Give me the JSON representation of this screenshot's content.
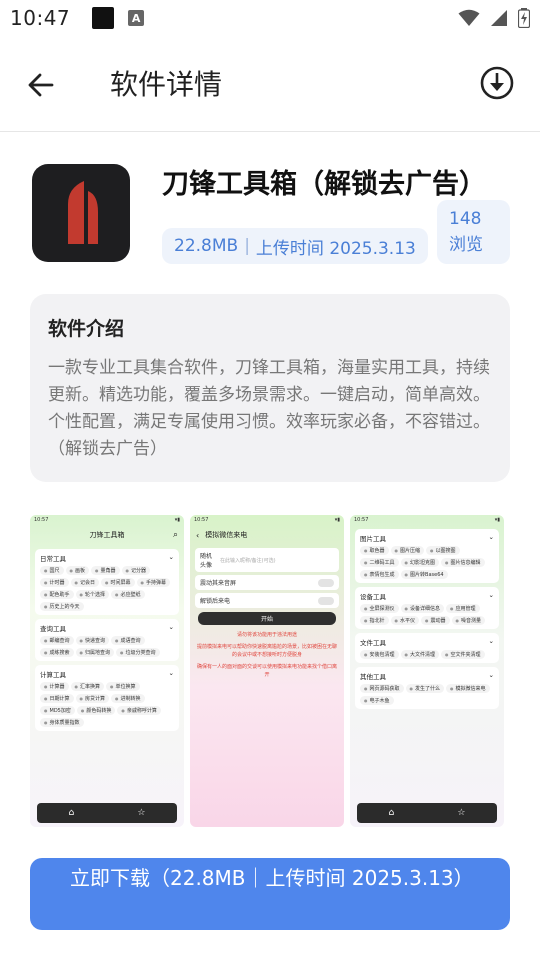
{
  "status_bar": {
    "time": "10:47",
    "icons": [
      "black-square-icon",
      "a-notification-icon",
      "wifi-icon",
      "signal-icon",
      "battery-charging-icon"
    ]
  },
  "app_bar": {
    "title": "软件详情",
    "back_icon": "arrow-left-icon",
    "download_icon": "download-circle-icon"
  },
  "app": {
    "name": "刀锋工具箱（解锁去广告）",
    "size": "22.8MB",
    "upload_time": "上传时间 2025.3.13",
    "views": "148浏览",
    "icon_colors": {
      "background": "#1e1e20",
      "mark": "#c23a2f"
    }
  },
  "intro": {
    "title": "软件介绍",
    "text": "一款专业工具集合软件，刀锋工具箱，海量实用工具，持续更新。精选功能，覆盖多场景需求。一键启动，简单高效。个性配置，满足专属使用习惯。效率玩家必备，不容错过。（解锁去广告）"
  },
  "screenshots": {
    "shot1": {
      "time": "10:57",
      "title": "刀锋工具箱",
      "sections": [
        {
          "title": "日常工具",
          "items": [
            "国尺",
            "画板",
            "量角器",
            "记分器",
            "计时器",
            "记会日",
            "时间屏幕",
            "手持弹幕",
            "配色助手",
            "轮个选择",
            "必应壁纸",
            "历史上的今天"
          ]
        },
        {
          "title": "查询工具",
          "items": [
            "邮编查询",
            "快递查询",
            "成语查询",
            "成练搜索",
            "归属地查询",
            "垃圾分类查询"
          ]
        },
        {
          "title": "计算工具",
          "items": [
            "计算器",
            "汇率换算",
            "单位换算",
            "日期计算",
            "房贷计算",
            "进制转换",
            "MD5加密",
            "颜色码转换",
            "亲戚称呼计算",
            "身体质量指数"
          ]
        }
      ]
    },
    "shot2": {
      "time": "10:57",
      "title": "模拟微信来电",
      "avatar_label": "随机头像",
      "input_placeholder": "在此输入昵称/备注(可选)",
      "options": [
        "震动其来音屏",
        "解锁后来电"
      ],
      "start": "开始",
      "notes": [
        "请勿将该功能用于违法用途",
        "提前模拟来电可以帮助你快速脱离尴尬的场景，比如被困在无聊的会议中或不想接听时方便脱身",
        "确保有一人的面对面的交谈可以使用模拟来电功能来找个借口离开"
      ]
    },
    "shot3": {
      "time": "10:57",
      "sections": [
        {
          "title": "图片工具",
          "items": [
            "取色器",
            "图片压缩",
            "以图搜图",
            "二维码工具",
            "幻影坦克图",
            "图片信息编辑",
            "表情包生成",
            "图片转Base64"
          ]
        },
        {
          "title": "设备工具",
          "items": [
            "全屏探测仪",
            "设备详细信息",
            "应用管理",
            "指北针",
            "水平仪",
            "震动器",
            "噪音测量"
          ]
        },
        {
          "title": "文件工具",
          "items": [
            "安装包清理",
            "大文件清理",
            "空文件夹清理"
          ]
        },
        {
          "title": "其他工具",
          "items": [
            "网页源码获取",
            "发生了什么",
            "模拟微信来电",
            "电子木鱼"
          ]
        }
      ]
    }
  },
  "download_button": {
    "label": "立即下载（22.8MB｜上传时间 2025.3.13）"
  },
  "colors": {
    "accent": "#4f86ec",
    "pill_bg": "#eef3fb",
    "pill_text": "#4a7fd6",
    "card_bg": "#f2f2f4"
  }
}
